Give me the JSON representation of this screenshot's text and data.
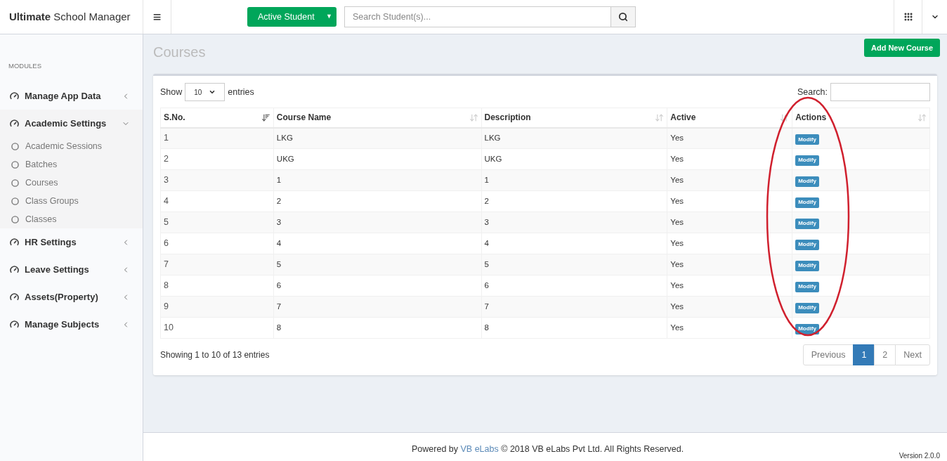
{
  "header": {
    "brand_bold": "Ultimate",
    "brand_rest": "School Manager",
    "menu_glyph": "≡",
    "student_button": "Active Student",
    "student_caret": "▼",
    "search": {
      "placeholder": "Search Student(s)..."
    }
  },
  "sidebar": {
    "heading": "MODULES",
    "items": [
      {
        "label": "Manage App Data",
        "expanded": false
      },
      {
        "label": "Academic Settings",
        "expanded": true,
        "children": [
          {
            "label": "Academic Sessions"
          },
          {
            "label": "Batches"
          },
          {
            "label": "Courses"
          },
          {
            "label": "Class Groups"
          },
          {
            "label": "Classes"
          }
        ]
      },
      {
        "label": "HR Settings",
        "expanded": false
      },
      {
        "label": "Leave Settings",
        "expanded": false
      },
      {
        "label": "Assets(Property)",
        "expanded": false
      },
      {
        "label": "Manage Subjects",
        "expanded": false
      }
    ]
  },
  "page": {
    "title": "Courses",
    "add_button": "Add New Course"
  },
  "table": {
    "show_label": "Show",
    "page_size": "10",
    "entries_label": "entries",
    "search_label": "Search:",
    "columns": [
      {
        "label": "S.No.",
        "sorted": true
      },
      {
        "label": "Course Name",
        "sorted": false
      },
      {
        "label": "Description",
        "sorted": false
      },
      {
        "label": "Active",
        "sorted": false
      },
      {
        "label": "Actions",
        "sorted": false
      }
    ],
    "rows": [
      {
        "sno": "1",
        "name": "LKG",
        "description": "LKG",
        "active": "Yes",
        "action": "Modify"
      },
      {
        "sno": "2",
        "name": "UKG",
        "description": "UKG",
        "active": "Yes",
        "action": "Modify"
      },
      {
        "sno": "3",
        "name": "1",
        "description": "1",
        "active": "Yes",
        "action": "Modify"
      },
      {
        "sno": "4",
        "name": "2",
        "description": "2",
        "active": "Yes",
        "action": "Modify"
      },
      {
        "sno": "5",
        "name": "3",
        "description": "3",
        "active": "Yes",
        "action": "Modify"
      },
      {
        "sno": "6",
        "name": "4",
        "description": "4",
        "active": "Yes",
        "action": "Modify"
      },
      {
        "sno": "7",
        "name": "5",
        "description": "5",
        "active": "Yes",
        "action": "Modify"
      },
      {
        "sno": "8",
        "name": "6",
        "description": "6",
        "active": "Yes",
        "action": "Modify"
      },
      {
        "sno": "9",
        "name": "7",
        "description": "7",
        "active": "Yes",
        "action": "Modify"
      },
      {
        "sno": "10",
        "name": "8",
        "description": "8",
        "active": "Yes",
        "action": "Modify"
      }
    ],
    "info": "Showing 1 to 10 of 13 entries",
    "pagination": [
      {
        "label": "Previous",
        "selected": false
      },
      {
        "label": "1",
        "selected": true
      },
      {
        "label": "2",
        "selected": false
      },
      {
        "label": "Next",
        "selected": false
      }
    ]
  },
  "annotation": {
    "kind": "ellipse",
    "color": "#d0202e"
  },
  "footer": {
    "powered": "Powered by",
    "link": "VB eLabs",
    "copyright": "© 2018 VB eLabs Pvt Ltd. All Rights Reserved.",
    "version": "Version 2.0.0"
  }
}
